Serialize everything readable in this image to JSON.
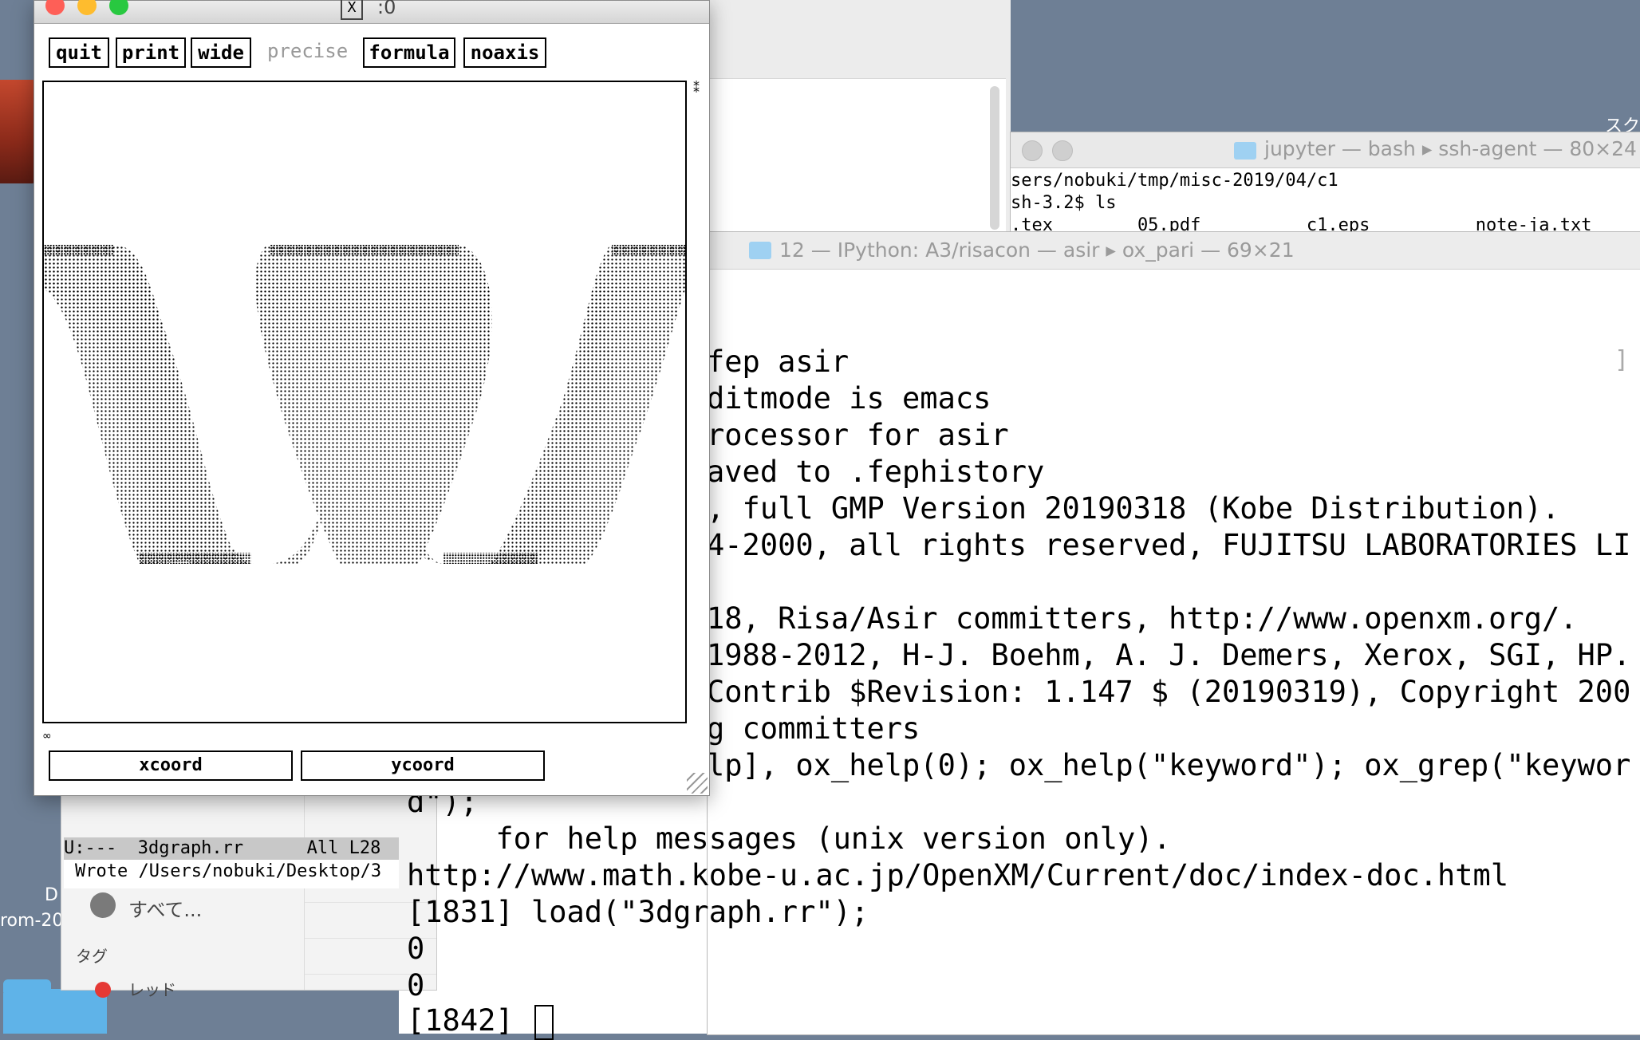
{
  "graph_window": {
    "title": ":0",
    "buttons": [
      "quit",
      "print",
      "wide",
      "precise",
      "formula",
      "noaxis"
    ],
    "corner_mark_top": "⁑",
    "corner_mark_bottom": "∞",
    "xcoord_label": "xcoord",
    "ycoord_label": "ycoord"
  },
  "jupyter_terminal": {
    "title": "jupyter — bash ▸ ssh-agent — 80×24",
    "lines": [
      "sers/nobuki/tmp/misc-2019/04/c1",
      "sh-3.2$ ls",
      ".tex        05.pdf          c1.eps          note-ja.txt"
    ],
    "side_fragments": [
      "tx",
      ".t",
      "e.",
      "is",
      "3"
    ]
  },
  "asir_terminal": {
    "title": "12 — IPython: A3/risacon — asir ▸ ox_pari — 69×21",
    "lines": [
      "fep asir",
      "ditmode is emacs",
      "rocessor for asir",
      "aved to .fephistory",
      ", full GMP Version 20190318 (Kobe Distribution).",
      "4-2000, all rights reserved, FUJITSU LABORATORIES LI",
      "",
      "18, Risa/Asir committers, http://www.openxm.org/.",
      "1988-2012, H-J. Boehm, A. J. Demers, Xerox, SGI, HP.",
      "Contrib $Revision: 1.147 $ (20190319), Copyright 200",
      "g committers",
      "lp], ox_help(0); ox_help(\"keyword\"); ox_grep(\"keywor"
    ],
    "full_lines": [
      "d\");",
      "     for help messages (unix version only).",
      "http://www.math.kobe-u.ac.jp/OpenXM/Current/doc/index-doc.html",
      "[1831] load(\"3dgraph.rr\");",
      "0",
      "0",
      "[1842] "
    ]
  },
  "emacs": {
    "modeline": "U:---  3dgraph.rr      All L28",
    "echo": "Wrote /Users/nobuki/Desktop/3"
  },
  "finder": {
    "all_item": "すべて...",
    "tags_label": "タグ",
    "red_tag": "レッド"
  },
  "desktop": {
    "label_d": "D",
    "label_rom": "rom-20",
    "label_sku": "スク"
  },
  "colors": {
    "close": "#fe5f57",
    "minimize": "#febc2e",
    "zoom": "#28c840",
    "desktop": "#6e7f95"
  }
}
